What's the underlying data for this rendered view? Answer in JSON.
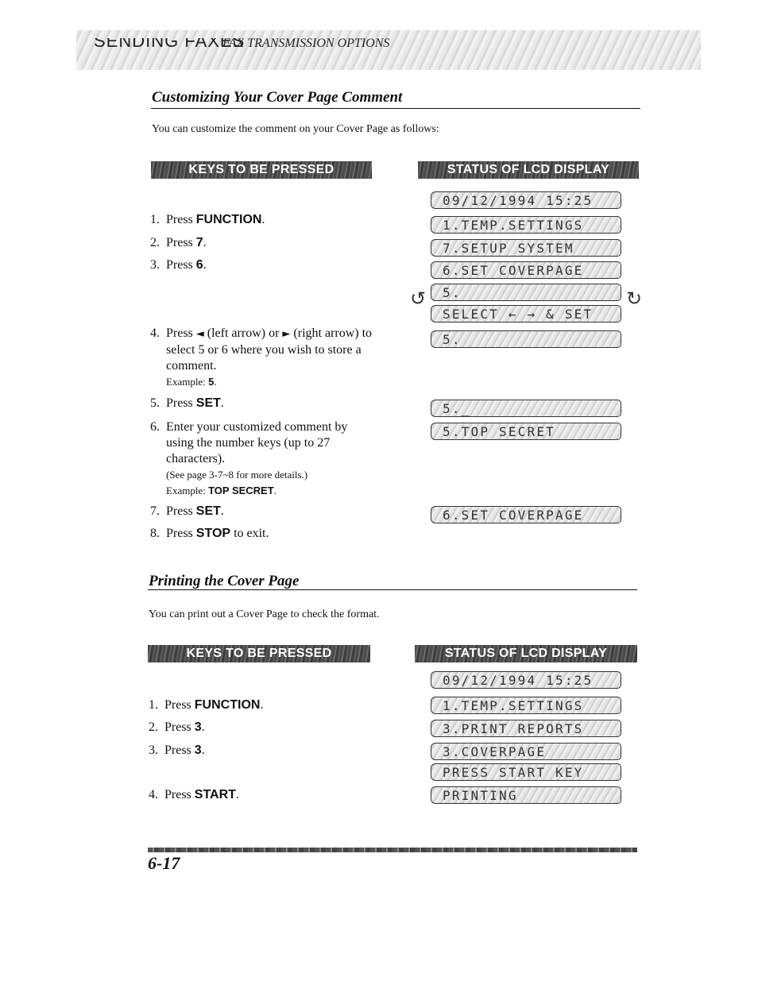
{
  "header": {
    "chapter": "SENDING FAXES",
    "section": "FAX TRANSMISSION OPTIONS"
  },
  "sections": [
    {
      "title": "Customizing Your Cover Page Comment",
      "intro": "You can customize the comment on your Cover Page as follows:",
      "keys_banner": "KEYS TO BE PRESSED",
      "lcd_banner": "STATUS OF LCD DISPLAY",
      "steps": [
        {
          "num": "1.",
          "pre": "Press ",
          "key": "FUNCTION",
          "post": "."
        },
        {
          "num": "2.",
          "pre": "Press ",
          "key": "7",
          "post": "."
        },
        {
          "num": "3.",
          "pre": "Press ",
          "key": "6",
          "post": "."
        },
        {
          "num": "4.",
          "pre": "Press ",
          "left_arrow_icon": "◄",
          "mid1": " (left arrow) or ",
          "right_arrow_icon": "►",
          "mid2": " (right arrow) to select 5 or 6 where you wish to store a comment.",
          "example_label": "Example: ",
          "example_value": "5",
          "example_post": "."
        },
        {
          "num": "5.",
          "pre": "Press ",
          "key": "SET",
          "post": "."
        },
        {
          "num": "6.",
          "pre": "Enter your customized comment by using the number keys (up to 27 characters).",
          "see": "(See page 3-7~8 for more details.)",
          "example_label": "Example: ",
          "example_value": "TOP SECRET",
          "example_post": "."
        },
        {
          "num": "7.",
          "pre": "Press ",
          "key": "SET",
          "post": "."
        },
        {
          "num": "8.",
          "pre": "Press ",
          "key": "STOP",
          "post": " to exit."
        }
      ],
      "lcd": [
        "09/12/1994 15:25",
        "1.TEMP.SETTINGS",
        "7.SETUP SYSTEM",
        "6.SET COVERPAGE",
        "5.",
        "SELECT ← → & SET",
        "5.",
        "5._",
        "5.TOP SECRET",
        "6.SET COVERPAGE"
      ],
      "loop_left_icon": "↺",
      "loop_right_icon": "↻"
    },
    {
      "title": "Printing the Cover Page",
      "intro": "You can print out a Cover Page to check the format.",
      "keys_banner": "KEYS TO BE PRESSED",
      "lcd_banner": "STATUS OF LCD DISPLAY",
      "steps": [
        {
          "num": "1.",
          "pre": "Press ",
          "key": "FUNCTION",
          "post": "."
        },
        {
          "num": "2.",
          "pre": "Press ",
          "key": "3",
          "post": "."
        },
        {
          "num": "3.",
          "pre": "Press ",
          "key": "3",
          "post": "."
        },
        {
          "num": "4.",
          "pre": "Press ",
          "key": "START",
          "post": "."
        }
      ],
      "lcd": [
        "09/12/1994 15:25",
        "1.TEMP.SETTINGS",
        "3.PRINT REPORTS",
        "3.COVERPAGE",
        "PRESS START KEY",
        "PRINTING"
      ]
    }
  ],
  "footer": {
    "page_number": "6-17"
  }
}
